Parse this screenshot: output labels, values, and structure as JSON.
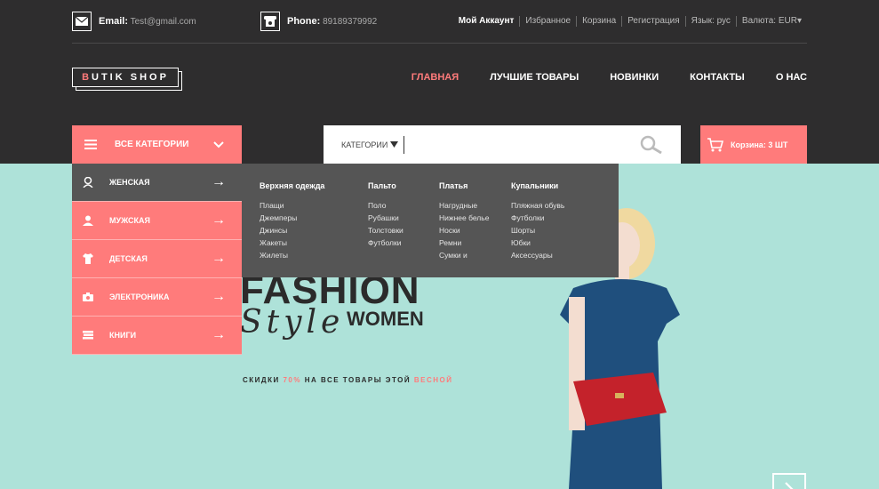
{
  "header": {
    "email_label": "Email:",
    "email_value": "Test@gmail.com",
    "phone_label": "Phone:",
    "phone_value": "89189379992",
    "links": [
      "Мой Аккаунт",
      "Избранное",
      "Корзина",
      "Регистрация",
      "Язык: рус",
      "Валюта: EUR▾"
    ]
  },
  "logo": {
    "first": "B",
    "rest": "UTIK SHOP"
  },
  "nav": [
    "ГЛАВНАЯ",
    "ЛУЧШИЕ ТОВАРЫ",
    "НОВИНКИ",
    "КОНТАКТЫ",
    "О НАС"
  ],
  "categories": {
    "label": "ВСЕ КАТЕГОРИИ",
    "items": [
      "ЖЕНСКАЯ",
      "МУЖСКАЯ",
      "ДЕТСКАЯ",
      "ЭЛЕКТРОНИКА",
      "КНИГИ"
    ]
  },
  "search": {
    "category": "КАТЕГОРИИ",
    "placeholder": ""
  },
  "cart": {
    "label": "Корзина: 3 ШТ"
  },
  "dropdown": [
    {
      "title": "Верхняя одежда",
      "items": [
        "Плащи",
        "Джемперы",
        "Джинсы",
        "Жакеты",
        "Жилеты"
      ]
    },
    {
      "title": "Пальто",
      "items": [
        "Поло",
        "Рубашки",
        "Толстовки",
        "Футболки"
      ]
    },
    {
      "title": "Платья",
      "items": [
        "Нагрудные",
        "Нижнее белье",
        "Носки",
        "Ремни",
        "Сумки и"
      ]
    },
    {
      "title": "Купальники",
      "items": [
        "Пляжная обувь",
        "Футболки",
        "Шорты",
        "Юбки",
        "Аксессуары"
      ]
    }
  ],
  "hero": {
    "fashion": "FASHION",
    "style": "Style",
    "women": "WOMEN",
    "promo_a": "СКИДКИ ",
    "promo_pct": "70%",
    "promo_b": " НА ВСЕ ТОВАРЫ ЭТОЙ ",
    "promo_c": "ВЕСНОЙ"
  },
  "colors": {
    "accent": "#ff7b7b",
    "dark": "#2e2d2e",
    "hero": "#aee2d9"
  }
}
